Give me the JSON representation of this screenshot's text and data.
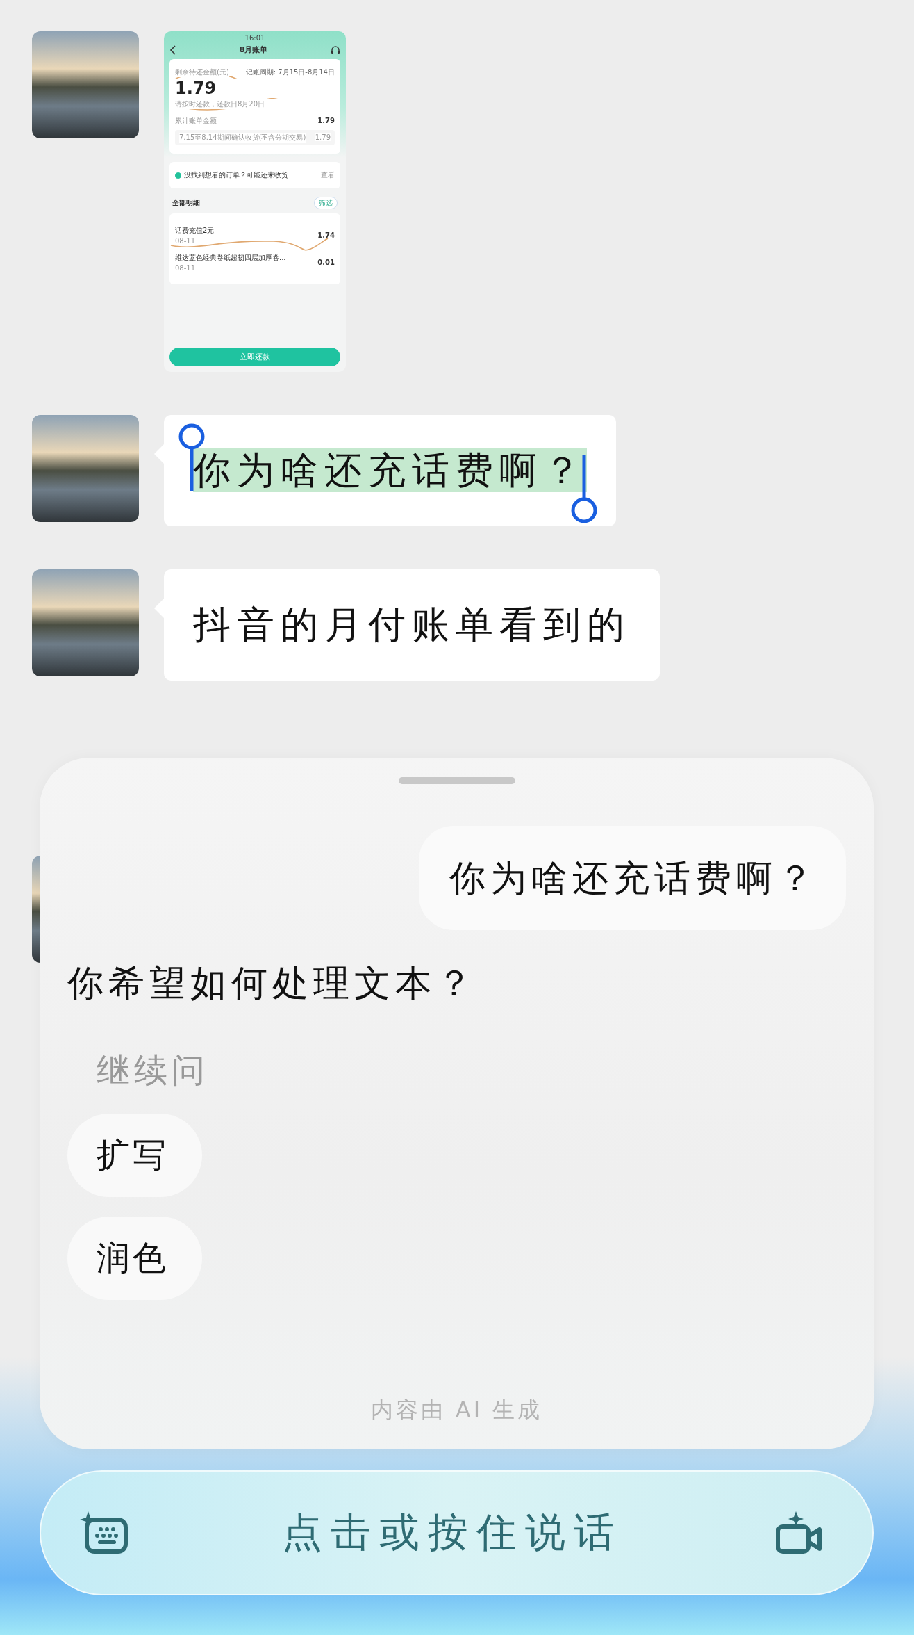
{
  "messages": [
    {
      "kind": "image",
      "screenshot": {
        "time": "16:01",
        "title": "8月账单",
        "balance_label": "剩余待还金额(元)",
        "period": "记账周期: 7月15日-8月14日",
        "amount": "1.79",
        "due": "请按时还款，还款日8月20日",
        "total_label": "累计账单金额",
        "total": "1.79",
        "detail": "7.15至8.14期间确认收货(不含分期交易)",
        "detail_amount": "1.79",
        "notice": "没找到想看的订单？可能还未收货",
        "notice_link": "查看",
        "list_title": "全部明细",
        "filter": "筛选",
        "items": [
          {
            "name": "话费充值2元",
            "date": "08-11",
            "amount": "1.74"
          },
          {
            "name": "维达蓝色经典卷纸超韧四层加厚卷...",
            "date": "08-11",
            "amount": "0.01"
          }
        ],
        "pay_button": "立即还款"
      }
    },
    {
      "kind": "text",
      "text": "你为啥还充话费啊？",
      "selected": true
    },
    {
      "kind": "text",
      "text": "抖音的月付账单看到的",
      "selected": false
    },
    {
      "kind": "hidden"
    }
  ],
  "sheet": {
    "quoted": "你为啥还充话费啊？",
    "question": "你希望如何处理文本？",
    "section_label": "继续问",
    "options": [
      "扩写",
      "润色"
    ],
    "footer": "内容由 AI 生成"
  },
  "input_bar": {
    "label": "点击或按住说话"
  }
}
